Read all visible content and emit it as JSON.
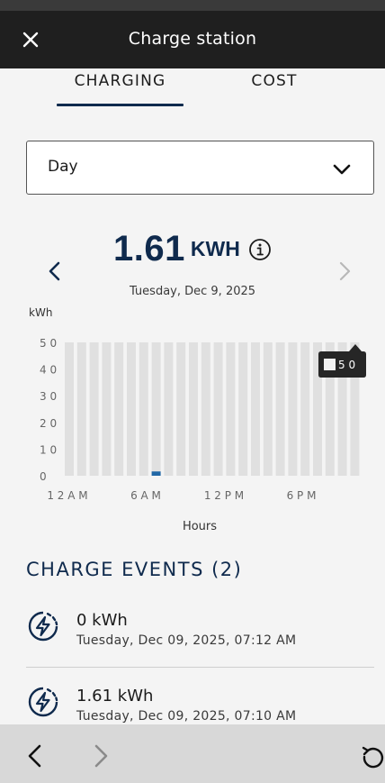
{
  "header": {
    "title": "Charge station",
    "close_icon": "close-icon"
  },
  "tabs": [
    {
      "label": "CHARGING",
      "selected": true
    },
    {
      "label": "COST",
      "selected": false
    }
  ],
  "period_select": {
    "value": "Day",
    "icon": "chevron-down-icon"
  },
  "summary": {
    "value": "1.61",
    "unit": "KWH",
    "date": "Tuesday, Dec 9, 2025",
    "prev_icon": "chevron-left-icon",
    "next_icon": "chevron-right-icon",
    "info_icon": "info-icon"
  },
  "tooltip": {
    "value": "5 0"
  },
  "chart_data": {
    "type": "bar",
    "ylabel": "kWh",
    "xlabel": "Hours",
    "ylim": [
      0,
      50
    ],
    "yticks": [
      "5 0",
      "4 0",
      "3 0",
      "2 0",
      "1 0",
      "0"
    ],
    "xticks": [
      "1 2 A M",
      "6 A M",
      "1 2 P M",
      "6 P M"
    ],
    "categories": [
      "0",
      "1",
      "2",
      "3",
      "4",
      "5",
      "6",
      "7",
      "8",
      "9",
      "10",
      "11",
      "12",
      "13",
      "14",
      "15",
      "16",
      "17",
      "18",
      "19",
      "20",
      "21",
      "22",
      "23"
    ],
    "values": [
      0,
      0,
      0,
      0,
      0,
      0,
      0,
      1.61,
      0,
      0,
      0,
      0,
      0,
      0,
      0,
      0,
      0,
      0,
      0,
      0,
      0,
      0,
      0,
      0
    ],
    "background_bar_value": 50,
    "colors": {
      "bar": "#2167a6",
      "background_bar": "#e0e0e0",
      "axis_text": "#666666"
    }
  },
  "events": {
    "title": "CHARGE EVENTS (2)",
    "icon": "lightning-bolt-icon",
    "items": [
      {
        "energy": "0 kWh",
        "time": "Tuesday, Dec 09, 2025, 07:12 AM"
      },
      {
        "energy": "1.61 kWh",
        "time": "Tuesday, Dec 09, 2025, 07:10 AM"
      }
    ]
  },
  "browser_nav": {
    "back_icon": "back-arrow-icon",
    "forward_icon": "forward-arrow-icon",
    "reload_icon": "reload-icon"
  },
  "colors": {
    "header_bg": "#1f1f1f",
    "accent": "#0f2a4d",
    "page_bg": "#f4f4f4"
  }
}
